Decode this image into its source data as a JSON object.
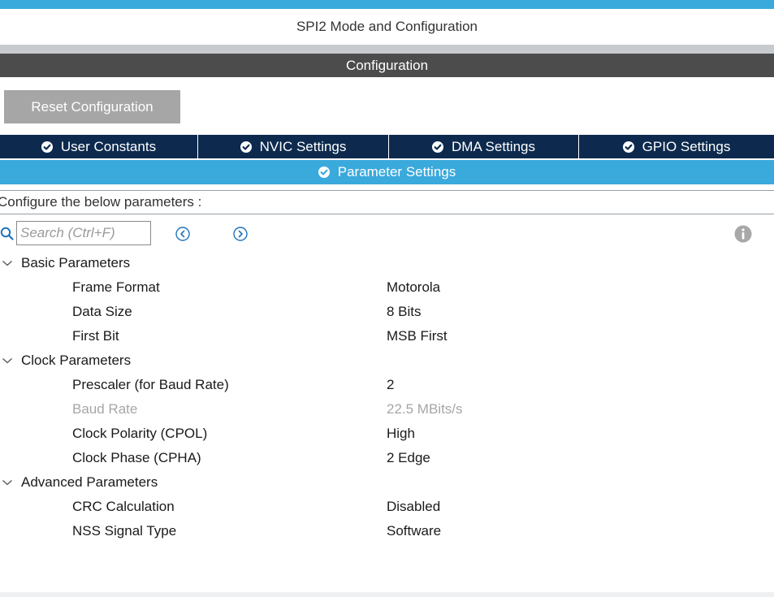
{
  "header": {
    "mode_title": "SPI2 Mode and Configuration",
    "config_title": "Configuration"
  },
  "toolbar": {
    "reset_label": "Reset Configuration"
  },
  "tabs": [
    {
      "label": "User Constants",
      "icon": "check-circle-icon"
    },
    {
      "label": "NVIC Settings",
      "icon": "check-circle-icon"
    },
    {
      "label": "DMA Settings",
      "icon": "check-circle-icon"
    },
    {
      "label": "GPIO Settings",
      "icon": "check-circle-icon"
    }
  ],
  "active_tab": {
    "label": "Parameter Settings",
    "icon": "check-circle-icon"
  },
  "configure_text": "Configure the below parameters :",
  "search": {
    "placeholder": "Search (Ctrl+F)",
    "value": ""
  },
  "groups": [
    {
      "label": "Basic Parameters",
      "params": [
        {
          "name": "Frame Format",
          "value": "Motorola"
        },
        {
          "name": "Data Size",
          "value": "8 Bits"
        },
        {
          "name": "First Bit",
          "value": "MSB First"
        }
      ]
    },
    {
      "label": "Clock Parameters",
      "params": [
        {
          "name": "Prescaler (for Baud Rate)",
          "value": "2"
        },
        {
          "name": "Baud Rate",
          "value": "22.5 MBits/s",
          "disabled": true
        },
        {
          "name": "Clock Polarity (CPOL)",
          "value": "High"
        },
        {
          "name": "Clock Phase (CPHA)",
          "value": "2 Edge"
        }
      ]
    },
    {
      "label": "Advanced Parameters",
      "params": [
        {
          "name": "CRC Calculation",
          "value": "Disabled"
        },
        {
          "name": "NSS Signal Type",
          "value": "Software"
        }
      ]
    }
  ],
  "colors": {
    "accent_blue": "#3aa9dc",
    "tab_navy": "#0d2a4e",
    "config_bar": "#4c4c4c",
    "button_gray": "#a6a6a6",
    "disabled_text": "#a6a6a6"
  }
}
